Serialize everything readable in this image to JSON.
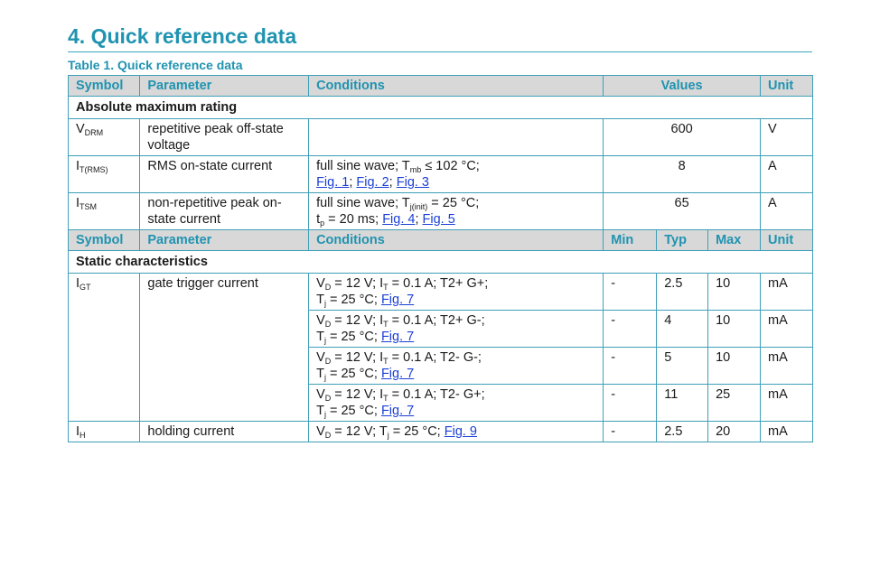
{
  "section": {
    "title": "4. Quick reference data"
  },
  "table": {
    "caption": "Table 1. Quick reference data",
    "header1": {
      "symbol": "Symbol",
      "parameter": "Parameter",
      "conditions": "Conditions",
      "values": "Values",
      "unit": "Unit"
    },
    "group1": "Absolute maximum rating",
    "abs_rows": [
      {
        "sym_main": "V",
        "sym_sub": "DRM",
        "param": "repetitive peak off-state voltage",
        "cond_a": "",
        "value": "600",
        "unit": "V"
      },
      {
        "sym_main": "I",
        "sym_sub": "T(RMS)",
        "param": "RMS on-state current",
        "cond_a": "full sine wave; T",
        "cond_a_sub": "mb",
        "cond_a_tail": " ≤ 102 °C;",
        "figs": [
          "Fig. 1",
          "Fig. 2",
          "Fig. 3"
        ],
        "value": "8",
        "unit": "A"
      },
      {
        "sym_main": "I",
        "sym_sub": "TSM",
        "param": "non-repetitive peak on-state current",
        "cond_a": "full sine wave; T",
        "cond_a_sub": "j(init)",
        "cond_a_tail": " = 25 °C;",
        "cond_b": "t",
        "cond_b_sub": "p",
        "cond_b_tail": " = 20 ms; ",
        "figs": [
          "Fig. 4",
          "Fig. 5"
        ],
        "value": "65",
        "unit": "A"
      }
    ],
    "header2": {
      "symbol": "Symbol",
      "parameter": "Parameter",
      "conditions": "Conditions",
      "min": "Min",
      "typ": "Typ",
      "max": "Max",
      "unit": "Unit"
    },
    "group2": "Static characteristics",
    "igt": {
      "sym_main": "I",
      "sym_sub": "GT",
      "param": "gate trigger current",
      "rows": [
        {
          "polarity": "T2+ G+;",
          "fig": "Fig. 7",
          "min": "-",
          "typ": "2.5",
          "max": "10",
          "unit": "mA"
        },
        {
          "polarity": "T2+ G-;",
          "fig": "Fig. 7",
          "min": "-",
          "typ": "4",
          "max": "10",
          "unit": "mA"
        },
        {
          "polarity": "T2- G-;",
          "fig": "Fig. 7",
          "min": "-",
          "typ": "5",
          "max": "10",
          "unit": "mA"
        },
        {
          "polarity": "T2- G+;",
          "fig": "Fig. 7",
          "min": "-",
          "typ": "11",
          "max": "25",
          "unit": "mA"
        }
      ]
    },
    "ih": {
      "sym_main": "I",
      "sym_sub": "H",
      "param": "holding current",
      "fig": "Fig. 9",
      "min": "-",
      "typ": "2.5",
      "max": "20",
      "unit": "mA"
    }
  },
  "colors": {
    "accent": "#1f93b0",
    "border": "#3f9fb8",
    "header_bg": "#d8d8d8",
    "link": "#1a3fd6"
  }
}
